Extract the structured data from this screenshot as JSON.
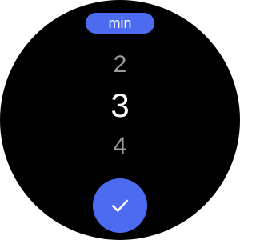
{
  "unit_selector": {
    "label": "min"
  },
  "picker": {
    "previous": "2",
    "current": "3",
    "next": "4"
  },
  "confirm": {
    "icon": "checkmark-icon"
  },
  "colors": {
    "accent": "#4d6bf1",
    "background": "#000000",
    "selected_text": "#ffffff",
    "dim_text": "#9c9c9c"
  }
}
